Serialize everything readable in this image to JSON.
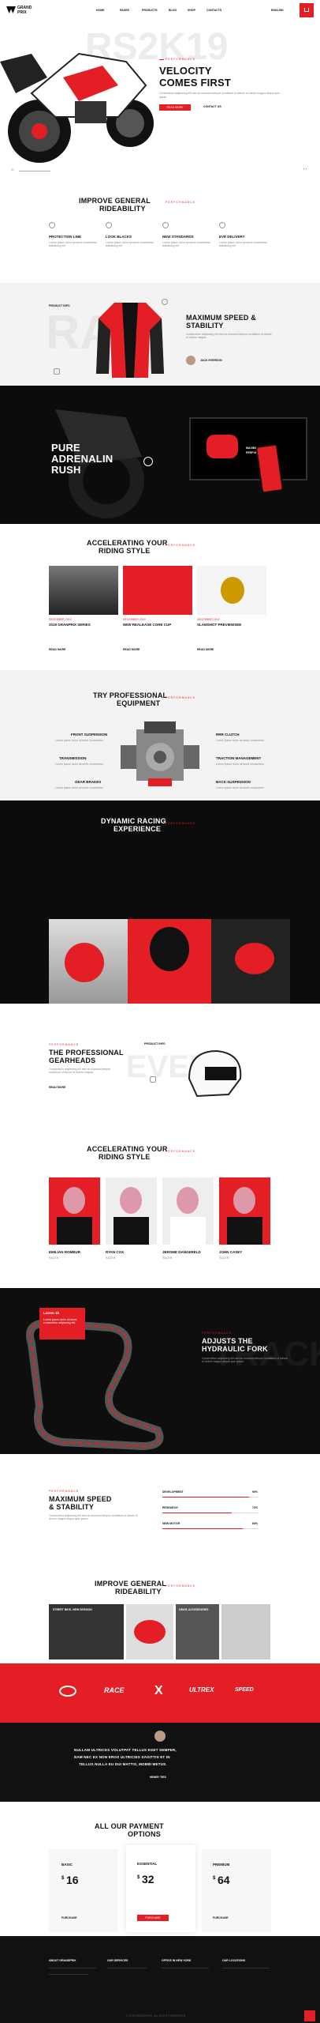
{
  "header": {
    "brand_1": "GRAND",
    "brand_2": "PRIX",
    "nav": [
      "HOME",
      "PAGES",
      "PRODUCTS",
      "BLOG",
      "SHOP",
      "CONTACTS"
    ],
    "lang": "ENGLISH"
  },
  "hero": {
    "sub": "PERFORMANCE",
    "title_1": "VELOCITY",
    "title_2": "COMES FIRST",
    "bg_text": "RS2K19",
    "text": "Consectetur adipiscing elit sed do eiusmod tempor incididunt ut labore et dolore magna aliqua quis ipsum.",
    "btn": "READ MORE",
    "link": "CONTACT US",
    "slide": "01"
  },
  "rideability": {
    "title_1": "IMPROVE GENERAL",
    "title_2": "RIDEABILITY",
    "sub": "PERFORMANCE",
    "features": [
      {
        "title": "PROTECTION LINE",
        "text": "Lorem ipsum dolor sit amet consectetur adipiscing elit"
      },
      {
        "title": "LOOK BLACKS",
        "text": "Lorem ipsum dolor sit amet consectetur adipiscing elit"
      },
      {
        "title": "NEW STANDARDS",
        "text": "Lorem ipsum dolor sit amet consectetur adipiscing elit"
      },
      {
        "title": "EVE DELIVERY",
        "text": "Lorem ipsum dolor sit amet consectetur adipiscing elit"
      }
    ]
  },
  "speed": {
    "sub": "PERFORMANCE",
    "title_1": "MAXIMUM SPEED &",
    "title_2": "STABILITY",
    "text": "Consectetur adipiscing elit sed do eiusmod tempor incididunt ut labore et dolore magna.",
    "author": "JACK EVERSON",
    "product_label": "PRODUCT INFO"
  },
  "adrenalin": {
    "title_1": "PURE",
    "title_2": "ADRENALIN",
    "title_3": "RUSH",
    "screen_title_1": "MAXIMUM",
    "screen_title_2": "PERFORMANCE"
  },
  "riding": {
    "title_1": "ACCELERATING YOUR",
    "title_2": "RIDING STYLE",
    "sub": "PERFORMANCE",
    "items": [
      {
        "tag": "DECEMBER 2019",
        "title": "2019 GRANPRIX SERIES",
        "more": "READ MORE"
      },
      {
        "tag": "DECEMBER 2019",
        "title": "NEW REALEASE CORE CUP",
        "more": "READ MORE"
      },
      {
        "tag": "DECEMBER 2019",
        "title": "SLAMSHOT PREVIEWSEE",
        "more": "READ MORE"
      }
    ]
  },
  "equipment": {
    "title_1": "TRY PROFESSIONAL",
    "title_2": "EQUIPMENT",
    "sub": "PERFORMANCE",
    "left": [
      {
        "title": "FRONT SUSPENSION",
        "text": "Lorem ipsum dolor sit amet consectetur"
      },
      {
        "title": "TRANSMISSION",
        "text": "Lorem ipsum dolor sit amet consectetur"
      },
      {
        "title": "GEAR BRAKES",
        "text": "Lorem ipsum dolor sit amet consectetur"
      }
    ],
    "right": [
      {
        "title": "RRR CLUTCH",
        "text": "Lorem ipsum dolor sit amet consectetur"
      },
      {
        "title": "TRACTION MANAGEMENT",
        "text": "Lorem ipsum dolor sit amet consectetur"
      },
      {
        "title": "BACK SUSPENSION",
        "text": "Lorem ipsum dolor sit amet consectetur"
      }
    ]
  },
  "racing": {
    "title_1": "DYNAMIC RACING",
    "title_2": "EXPERIENCE",
    "sub": "PERFORMANCE"
  },
  "gearheads": {
    "sub": "PERFORMANCE",
    "title_1": "THE PROFESSIONAL",
    "title_2": "GEARHEADS",
    "text": "Consectetur adipiscing elit sed do eiusmod tempor incididunt ut labore et dolore magna.",
    "more": "READ MORE",
    "product_label": "PRODUCT INFO",
    "bg_text": "EVERY"
  },
  "team": {
    "title_1": "ACCELERATING YOUR",
    "title_2": "RIDING STYLE",
    "sub": "PERFORMANCE",
    "members": [
      {
        "name": "EMILIAN ROMBUR",
        "role": "RACER"
      },
      {
        "name": "RYAN COX",
        "role": "RACER"
      },
      {
        "name": "JEROME DANGERELD",
        "role": "RACER"
      },
      {
        "name": "JOHN CASEY",
        "role": "RACER"
      }
    ]
  },
  "fork": {
    "sub": "PERFORMANCE",
    "title_1": "ADJUSTS THE",
    "title_2": "HYDRAULIC FORK",
    "text": "Consectetur adipiscing elit sed do eiusmod tempor incididunt ut labore et dolore magna aliqua quis ipsum.",
    "card_title": "Lorem 1k",
    "card_text": "Lorem ipsum dolor sit amet, consectetur adipiscing elit.",
    "bg_text": "TRACK"
  },
  "stability": {
    "sub": "PERFORMANCE",
    "title_1": "MAXIMUM SPEED",
    "title_2": "& STABILITY",
    "text": "Consectetur adipiscing elit sed do eiusmod tempor incididunt ut labore et dolore magna aliqua quis ipsum.",
    "bars": [
      {
        "label": "DEVELOPMENT",
        "value": 90
      },
      {
        "label": "RESEARCH",
        "value": 72
      },
      {
        "label": "NEW MOTOR",
        "value": 84
      }
    ]
  },
  "gallery": {
    "title_1": "IMPROVE GENERAL",
    "title_2": "RIDEABILITY",
    "sub": "PERFORMANCE",
    "cap_1": "STREET BIKE, NEW SESSION",
    "cap_2": "GEAR, ACCESSORIES"
  },
  "brands": [
    "RACE",
    "X",
    "ULTREX",
    "SPEED"
  ],
  "quote": {
    "text_1": "NULLAM ULTRICES VOLUTPAT TELLUS EGET SEMPER,",
    "text_2": "NAM NEC EX NON EROS ULTRICIES SAGITTIS ET IN",
    "text_3": "TELLUS NULLA EU DUI MATTIS, MOBBI METUS.",
    "name": "HENRY TIES"
  },
  "pricing": {
    "title_1": "ALL OUR PAYMENT",
    "title_2": "OPTIONS",
    "plans": [
      {
        "name": "BASIC",
        "price": "16",
        "currency": "$",
        "btn": "PURCHASE"
      },
      {
        "name": "ESSENTIAL",
        "price": "32",
        "currency": "$",
        "btn": "PURCHASE"
      },
      {
        "name": "PREMIUM",
        "price": "64",
        "currency": "$",
        "btn": "PURCHASE"
      }
    ]
  },
  "footer": {
    "cols": [
      "ABOUT GRANDPRIX",
      "OUR SERVICES",
      "OFFICE IN NEW YORK",
      "OUR LOCATIONS"
    ],
    "copyright": "© 2019 GRANDPRIX. ALL RIGHTS RESERVED"
  },
  "colors": {
    "accent": "#e31e24",
    "dark": "#111111",
    "light": "#f4f4f4"
  }
}
